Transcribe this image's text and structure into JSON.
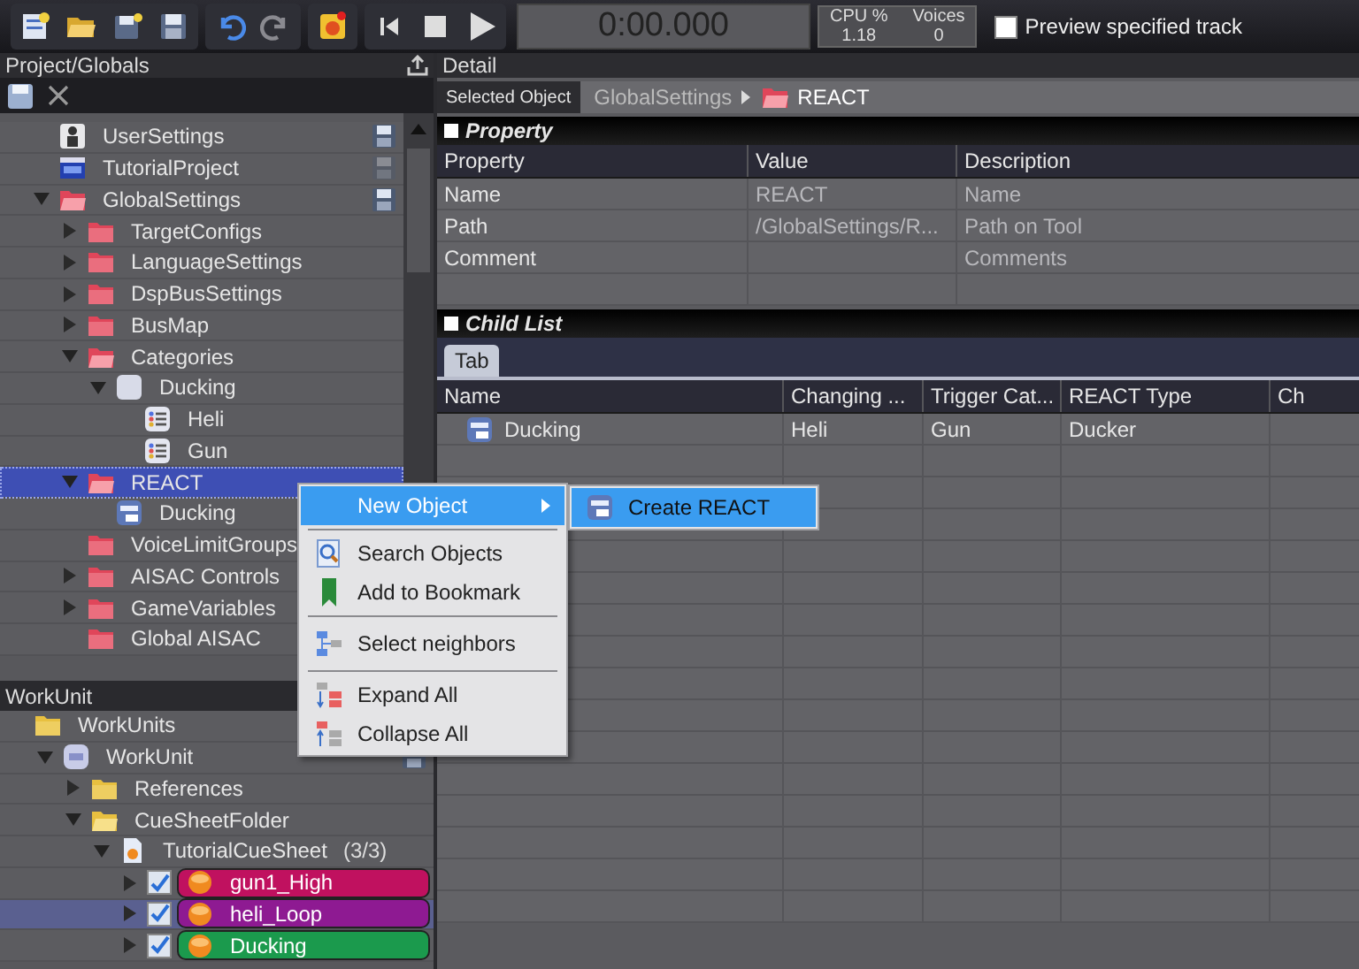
{
  "timer": "0:00.000",
  "cpu": {
    "label": "CPU %",
    "value": "1.18"
  },
  "voices": {
    "label": "Voices",
    "value": "0"
  },
  "preview": {
    "label": "Preview specified track",
    "checked": false
  },
  "project_panel": {
    "title": "Project/Globals",
    "tree": [
      {
        "label": "UserSettings",
        "kind": "user",
        "save": true,
        "save_enabled": true,
        "selected": false
      },
      {
        "label": "TutorialProject",
        "kind": "project",
        "save": true,
        "save_enabled": false,
        "selected": false
      },
      {
        "label": "GlobalSettings",
        "kind": "global-folder",
        "save": true,
        "save_enabled": true,
        "expanded": true,
        "selected": false,
        "children": [
          {
            "label": "TargetConfigs",
            "kind": "global-folder",
            "expanded": false,
            "selected": false
          },
          {
            "label": "LanguageSettings",
            "kind": "global-folder",
            "expanded": false,
            "selected": false
          },
          {
            "label": "DspBusSettings",
            "kind": "global-folder",
            "expanded": false,
            "selected": false
          },
          {
            "label": "BusMap",
            "kind": "global-folder",
            "expanded": false,
            "selected": false
          },
          {
            "label": "Categories",
            "kind": "global-folder",
            "expanded": true,
            "selected": false,
            "children": [
              {
                "label": "Ducking",
                "kind": "category",
                "expanded": true,
                "selected": false,
                "children": [
                  {
                    "label": "Heli",
                    "kind": "list",
                    "selected": false
                  },
                  {
                    "label": "Gun",
                    "kind": "list",
                    "selected": false
                  }
                ]
              }
            ]
          },
          {
            "label": "REACT",
            "kind": "global-folder",
            "expanded": true,
            "selected": true,
            "children": [
              {
                "label": "Ducking",
                "kind": "react",
                "selected": false
              }
            ]
          },
          {
            "label": "VoiceLimitGroups",
            "kind": "global-folder",
            "selected": false
          },
          {
            "label": "AISAC Controls",
            "kind": "global-folder",
            "expanded": false,
            "selected": false
          },
          {
            "label": "GameVariables",
            "kind": "global-folder",
            "expanded": false,
            "selected": false
          },
          {
            "label": "Global AISAC",
            "kind": "global-folder",
            "selected": false
          }
        ]
      }
    ]
  },
  "workunit_panel": {
    "title": "WorkUnit",
    "tree": [
      {
        "label": "WorkUnits",
        "kind": "folder",
        "selected": false,
        "children": [
          {
            "label": "WorkUnit",
            "kind": "workunit",
            "save": true,
            "save_enabled": true,
            "expanded": true,
            "selected": false,
            "children": [
              {
                "label": "References",
                "kind": "folder",
                "expanded": false,
                "selected": false
              },
              {
                "label": "CueSheetFolder",
                "kind": "folder",
                "expanded": true,
                "selected": false,
                "children": [
                  {
                    "label": "TutorialCueSheet",
                    "count": "(3/3)",
                    "kind": "cuesheet",
                    "expanded": true,
                    "selected": false,
                    "children": [
                      {
                        "label": "gun1_High",
                        "kind": "cue",
                        "checked": true,
                        "color": "#c0115f",
                        "expanded": false,
                        "selected": false
                      },
                      {
                        "label": "heli_Loop",
                        "kind": "cue",
                        "checked": true,
                        "color": "#8e1a92",
                        "expanded": false,
                        "selected": true
                      },
                      {
                        "label": "Ducking",
                        "kind": "cue",
                        "checked": true,
                        "color": "#1b9a4d",
                        "expanded": false,
                        "selected": false
                      }
                    ]
                  }
                ]
              }
            ]
          }
        ]
      }
    ]
  },
  "detail": {
    "title": "Detail",
    "selected_object_label": "Selected Object",
    "breadcrumb": [
      "GlobalSettings",
      "REACT"
    ],
    "property": {
      "title": "Property",
      "columns": [
        "Property",
        "Value",
        "Description"
      ],
      "rows": [
        [
          "Name",
          "REACT",
          "Name"
        ],
        [
          "Path",
          "/GlobalSettings/R...",
          "Path on Tool"
        ],
        [
          "Comment",
          "",
          "Comments"
        ]
      ]
    },
    "child_list": {
      "title": "Child List",
      "tabs": [
        {
          "label": "Tab",
          "selected": true
        }
      ],
      "columns": [
        "Name",
        "Changing ...",
        "Trigger Cat...",
        "REACT Type",
        "Ch"
      ],
      "rows": [
        [
          "Ducking",
          "Heli",
          "Gun",
          "Ducker"
        ]
      ]
    }
  },
  "context_menu": {
    "items": [
      {
        "kind": "new",
        "label": "New Object",
        "submenu": true,
        "selected": true
      },
      {
        "kind": "separator"
      },
      {
        "kind": "search",
        "label": "Search Objects",
        "selected": false
      },
      {
        "kind": "bookmark",
        "label": "Add to Bookmark",
        "selected": false
      },
      {
        "kind": "separator"
      },
      {
        "kind": "neighbors",
        "label": "Select neighbors",
        "selected": false
      },
      {
        "kind": "separator"
      },
      {
        "kind": "expand",
        "label": "Expand All",
        "selected": false
      },
      {
        "kind": "collapse",
        "label": "Collapse All",
        "selected": false
      }
    ]
  },
  "submenu": {
    "items": [
      {
        "label": "Create REACT",
        "selected": true
      }
    ]
  }
}
